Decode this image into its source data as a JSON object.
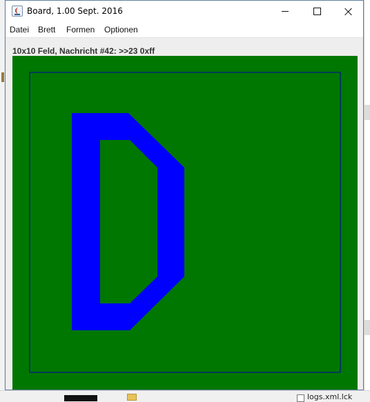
{
  "window": {
    "title": "Board, 1.00 Sept. 2016"
  },
  "menu": {
    "items": [
      "Datei",
      "Brett",
      "Formen",
      "Optionen"
    ]
  },
  "board": {
    "status": "10x10 Feld, Nachricht #42: >>23 0xff",
    "background_color": "#007700",
    "letter_color": "#0000ff",
    "grid_color": "#0000aa",
    "letter": "D"
  },
  "background": {
    "file_label": "logs.xml.lck"
  },
  "colors": {
    "window_border": "#5e7f9e",
    "content_bg": "#eeeeee"
  }
}
